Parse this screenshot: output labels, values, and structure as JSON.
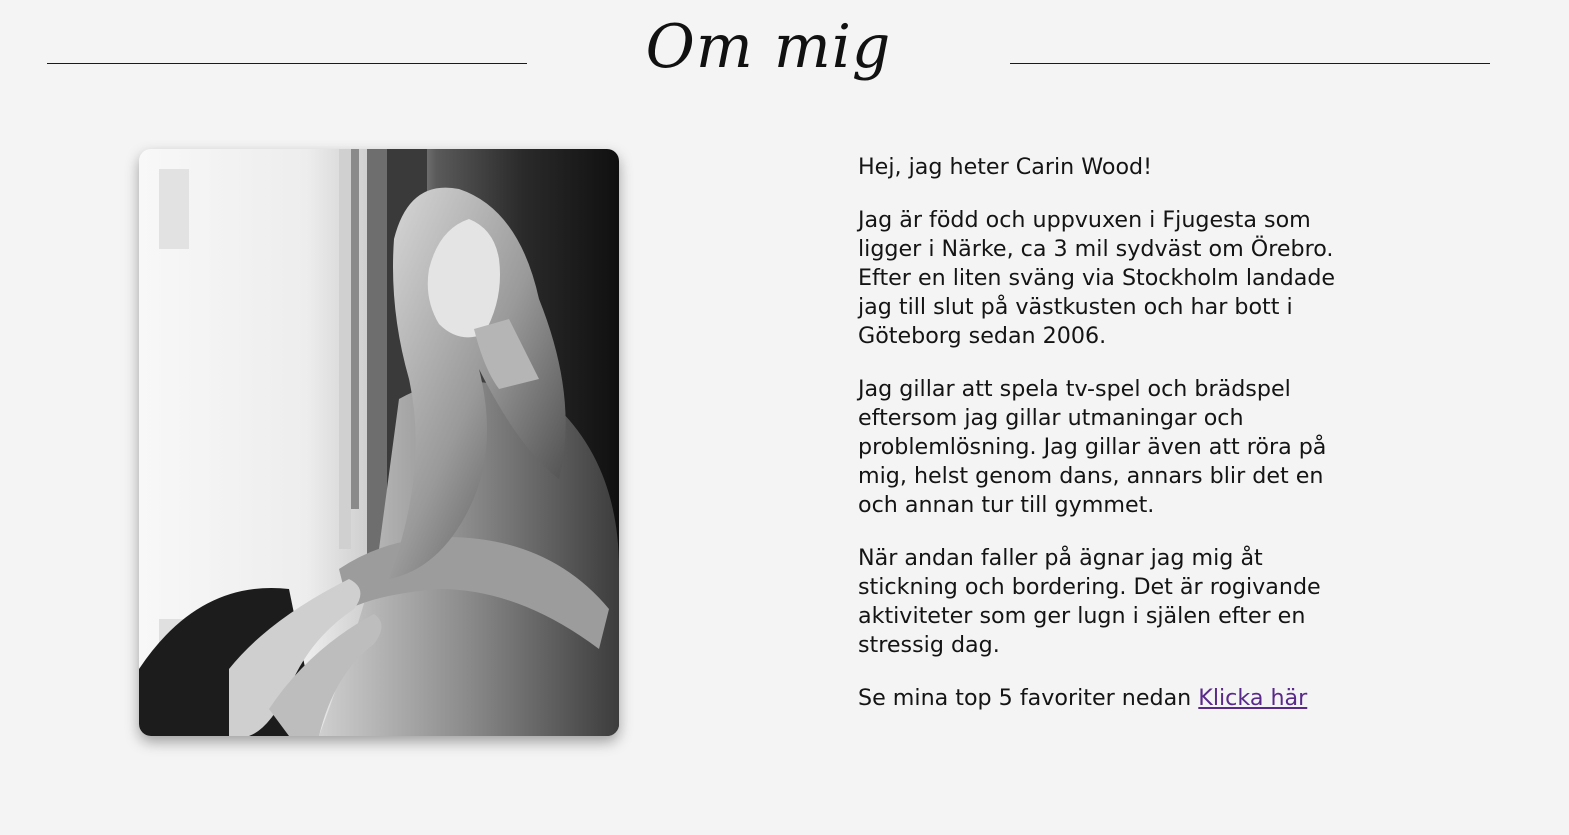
{
  "header": {
    "title": "Om mig"
  },
  "photo": {
    "icon": "portrait-photo"
  },
  "about": {
    "greeting": "Hej, jag heter Carin Wood!",
    "paragraph_1": "Jag är född och uppvuxen i Fjugesta som ligger i Närke, ca 3 mil sydväst om Örebro. Efter en liten sväng via Stockholm landade jag till slut på västkusten och har bott i Göteborg sedan 2006.",
    "paragraph_2": "Jag gillar att spela tv-spel och brädspel eftersom jag gillar utmaningar och problemlösning. Jag gillar även att röra på mig, helst genom dans, annars blir det en och annan tur till gymmet.",
    "paragraph_3": "När andan faller på ägnar jag mig åt stickning och bordering. Det är rogivande aktiviteter som ger lugn i själen efter en stressig dag.",
    "favorites_text": "Se mina top 5 favoriter nedan ",
    "favorites_link": "Klicka här"
  },
  "colors": {
    "background": "#f4f4f4",
    "link": "#5a2a8a",
    "text": "#141414"
  }
}
